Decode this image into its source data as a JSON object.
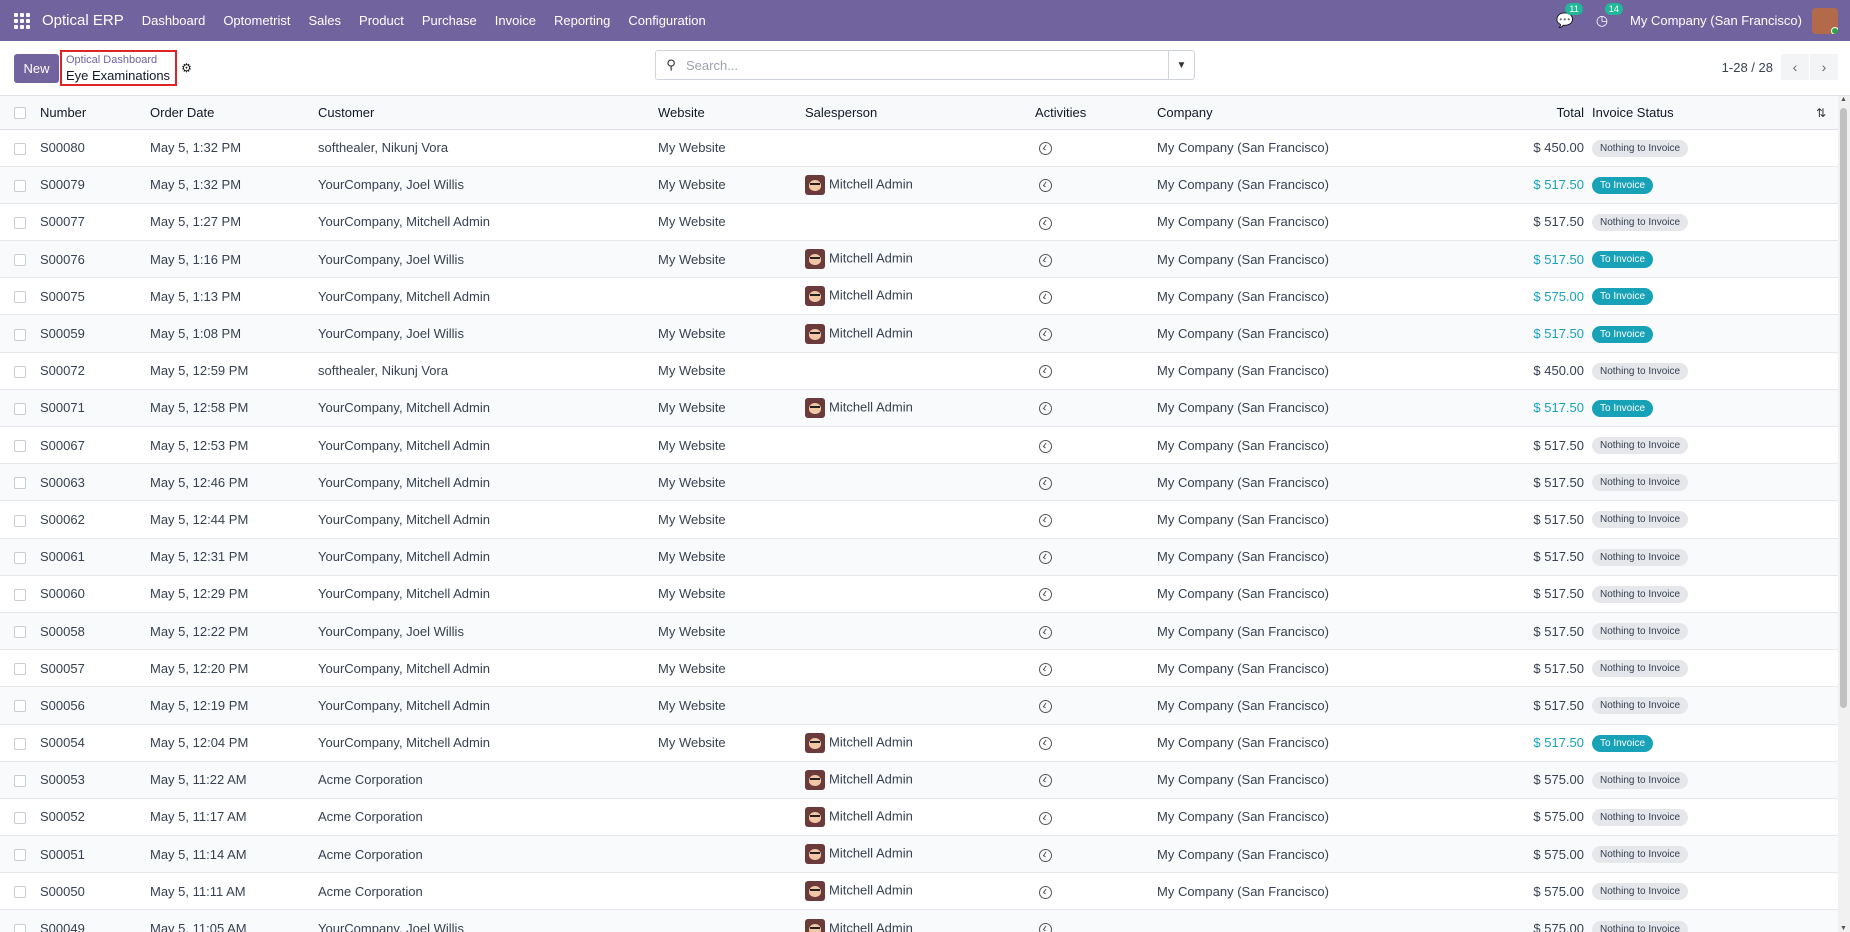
{
  "navbar": {
    "brand": "Optical ERP",
    "menu": [
      "Dashboard",
      "Optometrist",
      "Sales",
      "Product",
      "Purchase",
      "Invoice",
      "Reporting",
      "Configuration"
    ],
    "messages_count": "11",
    "activities_count": "14",
    "company": "My Company (San Francisco)",
    "colors": {
      "navbar": "#71639e"
    }
  },
  "control": {
    "new_label": "New",
    "breadcrumb_parent": "Optical Dashboard",
    "breadcrumb_current": "Eye Examinations",
    "search_placeholder": "Search...",
    "pager": "1-28 / 28"
  },
  "table": {
    "headers": {
      "number": "Number",
      "order_date": "Order Date",
      "customer": "Customer",
      "website": "Website",
      "salesperson": "Salesperson",
      "activities": "Activities",
      "company": "Company",
      "total": "Total",
      "invoice_status": "Invoice Status"
    },
    "rows": [
      {
        "number": "S00080",
        "date": "May 5, 1:32 PM",
        "customer": "softhealer, Nikunj Vora",
        "website": "My Website",
        "salesperson": "",
        "company": "My Company (San Francisco)",
        "total": "$ 450.00",
        "status": "Nothing to Invoice"
      },
      {
        "number": "S00079",
        "date": "May 5, 1:32 PM",
        "customer": "YourCompany, Joel Willis",
        "website": "My Website",
        "salesperson": "Mitchell Admin",
        "company": "My Company (San Francisco)",
        "total": "$ 517.50",
        "status": "To Invoice"
      },
      {
        "number": "S00077",
        "date": "May 5, 1:27 PM",
        "customer": "YourCompany, Mitchell Admin",
        "website": "My Website",
        "salesperson": "",
        "company": "My Company (San Francisco)",
        "total": "$ 517.50",
        "status": "Nothing to Invoice"
      },
      {
        "number": "S00076",
        "date": "May 5, 1:16 PM",
        "customer": "YourCompany, Joel Willis",
        "website": "My Website",
        "salesperson": "Mitchell Admin",
        "company": "My Company (San Francisco)",
        "total": "$ 517.50",
        "status": "To Invoice"
      },
      {
        "number": "S00075",
        "date": "May 5, 1:13 PM",
        "customer": "YourCompany, Mitchell Admin",
        "website": "",
        "salesperson": "Mitchell Admin",
        "company": "My Company (San Francisco)",
        "total": "$ 575.00",
        "status": "To Invoice"
      },
      {
        "number": "S00059",
        "date": "May 5, 1:08 PM",
        "customer": "YourCompany, Joel Willis",
        "website": "My Website",
        "salesperson": "Mitchell Admin",
        "company": "My Company (San Francisco)",
        "total": "$ 517.50",
        "status": "To Invoice"
      },
      {
        "number": "S00072",
        "date": "May 5, 12:59 PM",
        "customer": "softhealer, Nikunj Vora",
        "website": "My Website",
        "salesperson": "",
        "company": "My Company (San Francisco)",
        "total": "$ 450.00",
        "status": "Nothing to Invoice"
      },
      {
        "number": "S00071",
        "date": "May 5, 12:58 PM",
        "customer": "YourCompany, Mitchell Admin",
        "website": "My Website",
        "salesperson": "Mitchell Admin",
        "company": "My Company (San Francisco)",
        "total": "$ 517.50",
        "status": "To Invoice"
      },
      {
        "number": "S00067",
        "date": "May 5, 12:53 PM",
        "customer": "YourCompany, Mitchell Admin",
        "website": "My Website",
        "salesperson": "",
        "company": "My Company (San Francisco)",
        "total": "$ 517.50",
        "status": "Nothing to Invoice"
      },
      {
        "number": "S00063",
        "date": "May 5, 12:46 PM",
        "customer": "YourCompany, Mitchell Admin",
        "website": "My Website",
        "salesperson": "",
        "company": "My Company (San Francisco)",
        "total": "$ 517.50",
        "status": "Nothing to Invoice"
      },
      {
        "number": "S00062",
        "date": "May 5, 12:44 PM",
        "customer": "YourCompany, Mitchell Admin",
        "website": "My Website",
        "salesperson": "",
        "company": "My Company (San Francisco)",
        "total": "$ 517.50",
        "status": "Nothing to Invoice"
      },
      {
        "number": "S00061",
        "date": "May 5, 12:31 PM",
        "customer": "YourCompany, Mitchell Admin",
        "website": "My Website",
        "salesperson": "",
        "company": "My Company (San Francisco)",
        "total": "$ 517.50",
        "status": "Nothing to Invoice"
      },
      {
        "number": "S00060",
        "date": "May 5, 12:29 PM",
        "customer": "YourCompany, Mitchell Admin",
        "website": "My Website",
        "salesperson": "",
        "company": "My Company (San Francisco)",
        "total": "$ 517.50",
        "status": "Nothing to Invoice"
      },
      {
        "number": "S00058",
        "date": "May 5, 12:22 PM",
        "customer": "YourCompany, Joel Willis",
        "website": "My Website",
        "salesperson": "",
        "company": "My Company (San Francisco)",
        "total": "$ 517.50",
        "status": "Nothing to Invoice"
      },
      {
        "number": "S00057",
        "date": "May 5, 12:20 PM",
        "customer": "YourCompany, Mitchell Admin",
        "website": "My Website",
        "salesperson": "",
        "company": "My Company (San Francisco)",
        "total": "$ 517.50",
        "status": "Nothing to Invoice"
      },
      {
        "number": "S00056",
        "date": "May 5, 12:19 PM",
        "customer": "YourCompany, Mitchell Admin",
        "website": "My Website",
        "salesperson": "",
        "company": "My Company (San Francisco)",
        "total": "$ 517.50",
        "status": "Nothing to Invoice"
      },
      {
        "number": "S00054",
        "date": "May 5, 12:04 PM",
        "customer": "YourCompany, Mitchell Admin",
        "website": "My Website",
        "salesperson": "Mitchell Admin",
        "company": "My Company (San Francisco)",
        "total": "$ 517.50",
        "status": "To Invoice"
      },
      {
        "number": "S00053",
        "date": "May 5, 11:22 AM",
        "customer": "Acme Corporation",
        "website": "",
        "salesperson": "Mitchell Admin",
        "company": "My Company (San Francisco)",
        "total": "$ 575.00",
        "status": "Nothing to Invoice"
      },
      {
        "number": "S00052",
        "date": "May 5, 11:17 AM",
        "customer": "Acme Corporation",
        "website": "",
        "salesperson": "Mitchell Admin",
        "company": "My Company (San Francisco)",
        "total": "$ 575.00",
        "status": "Nothing to Invoice"
      },
      {
        "number": "S00051",
        "date": "May 5, 11:14 AM",
        "customer": "Acme Corporation",
        "website": "",
        "salesperson": "Mitchell Admin",
        "company": "My Company (San Francisco)",
        "total": "$ 575.00",
        "status": "Nothing to Invoice"
      },
      {
        "number": "S00050",
        "date": "May 5, 11:11 AM",
        "customer": "Acme Corporation",
        "website": "",
        "salesperson": "Mitchell Admin",
        "company": "My Company (San Francisco)",
        "total": "$ 575.00",
        "status": "Nothing to Invoice"
      },
      {
        "number": "S00049",
        "date": "May 5, 11:05 AM",
        "customer": "YourCompany, Joel Willis",
        "website": "",
        "salesperson": "Mitchell Admin",
        "company": "",
        "total": "$ 575.00",
        "status": "Nothing to Invoice"
      }
    ],
    "status_colors": {
      "to_invoice": "#17a2b8",
      "nothing_to_invoice": "#e5e7eb"
    }
  }
}
